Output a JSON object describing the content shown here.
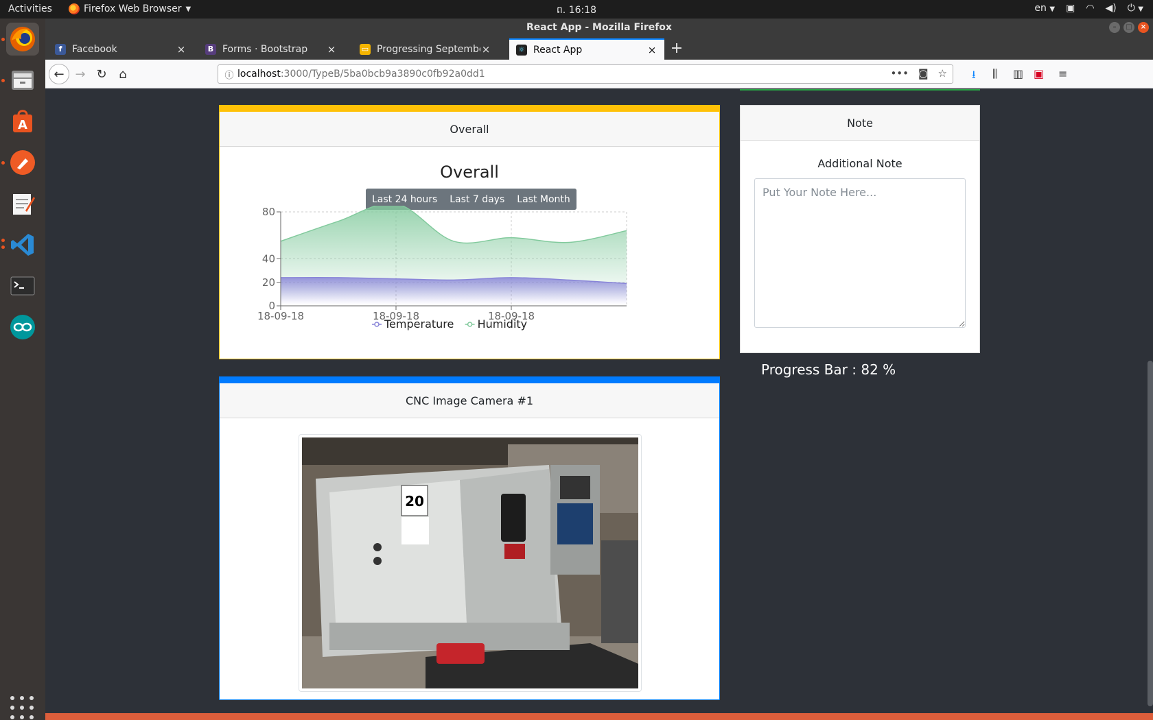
{
  "topbar": {
    "activities": "Activities",
    "app_menu": "Firefox Web Browser",
    "clock": "ព. 16:18",
    "lang": "en"
  },
  "window": {
    "title": "React App - Mozilla Firefox"
  },
  "tabs": [
    {
      "label": "Facebook",
      "favicon": "facebook-icon",
      "color": "#3b5998"
    },
    {
      "label": "Forms · Bootstrap",
      "favicon": "bootstrap-icon",
      "color": "#563d7c"
    },
    {
      "label": "Progressing September",
      "favicon": "slides-icon",
      "color": "#f4b400"
    },
    {
      "label": "React App",
      "favicon": "react-icon",
      "color": "#222222"
    }
  ],
  "url": {
    "host": "localhost",
    "path": ":3000/TypeB/5ba0bcb9a3890c0fb92a0dd1"
  },
  "overall": {
    "header": "Overall",
    "chart_title": "Overall",
    "range_buttons": [
      "Last 24 hours",
      "Last 7 days",
      "Last Month"
    ]
  },
  "chart_data": {
    "type": "area",
    "title": "Overall",
    "x": [
      0,
      1,
      2,
      3,
      4,
      5,
      6
    ],
    "x_tick_labels": [
      "18-09-18",
      "18-09-18",
      "18-09-18"
    ],
    "y_ticks": [
      0,
      20,
      40,
      80
    ],
    "ylim": [
      0,
      80
    ],
    "series": [
      {
        "name": "Temperature",
        "color": "#8884d8",
        "values": [
          24,
          24,
          23,
          22,
          24,
          22,
          19
        ]
      },
      {
        "name": "Humidity",
        "color": "#82ca9d",
        "values": [
          55,
          72,
          87,
          55,
          58,
          54,
          64
        ]
      }
    ],
    "legend": "bottom",
    "grid": true
  },
  "note": {
    "header": "Note",
    "title": "Additional Note",
    "placeholder": "Put Your Note Here..."
  },
  "progress": {
    "label": "Progress Bar : 82 %",
    "value": 82
  },
  "camera": {
    "header": "CNC Image Camera #1"
  }
}
